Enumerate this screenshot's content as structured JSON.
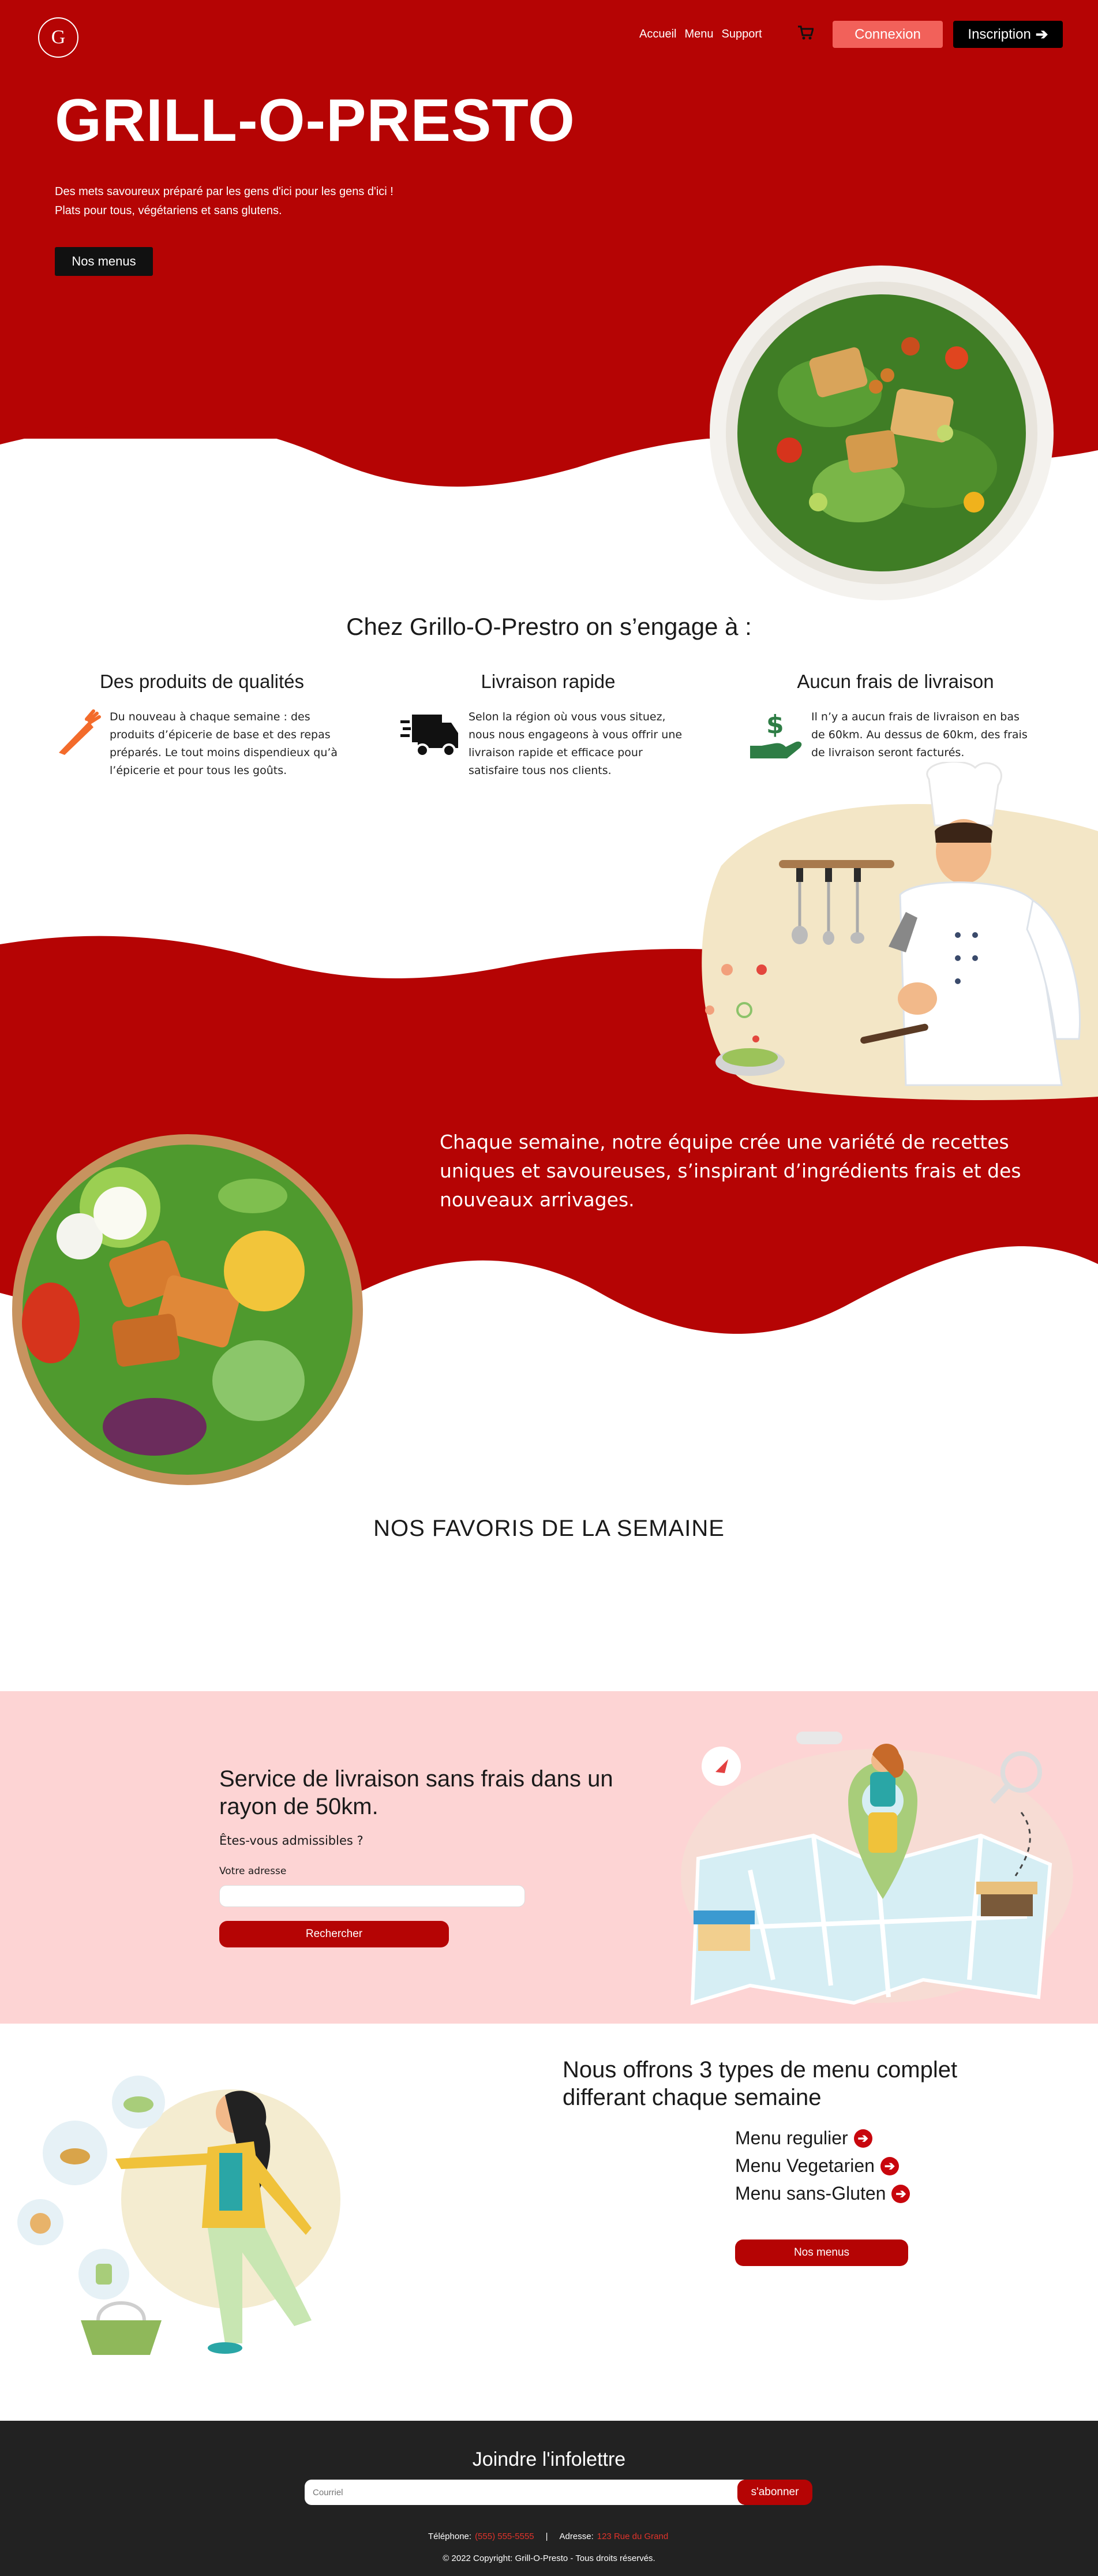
{
  "nav": {
    "logo_letter": "G",
    "links": [
      "Accueil",
      "Menu",
      "Support"
    ],
    "login_label": "Connexion",
    "signup_label": "Inscription"
  },
  "hero": {
    "title": "GRILL-O-PRESTO",
    "subtitle_line1": "Des mets savoureux préparé par les gens d'ici pour les gens d'ici !",
    "subtitle_line2": "Plats pour tous, végétariens et sans glutens.",
    "button_label": "Nos menus"
  },
  "engagement": {
    "title": "Chez Grillo-O-Prestro on s’engage à :",
    "features": [
      {
        "title": "Des produits de qualités",
        "text": "Du nouveau à chaque semaine : des produits d’épicerie de base et des repas préparés. Le tout moins dispendieux qu’à l’épicerie et pour tous les goûts.",
        "icon": "carrot-icon"
      },
      {
        "title": "Livraison rapide",
        "text": "Selon la région où vous vous situez, nous nous engageons à vous offrir une livraison rapide et efficace pour satisfaire tous nos clients.",
        "icon": "delivery-truck-icon"
      },
      {
        "title": "Aucun frais de livraison",
        "text": "Il n’y a aucun frais de livraison en bas de 60km. Au dessus de 60km, des frais de livraison seront facturés.",
        "icon": "money-hand-icon"
      }
    ]
  },
  "quote": {
    "text": "Chaque semaine, notre équipe crée une variété de recettes uniques et savoureuses, s’inspirant d’ingrédients frais et des nouveaux arrivages."
  },
  "favorites": {
    "title": "NOS FAVORIS DE LA SEMAINE"
  },
  "delivery": {
    "title": "Service de livraison sans frais dans un rayon de 50km.",
    "question": "Êtes-vous admissibles ?",
    "address_label": "Votre adresse",
    "address_value": "",
    "search_label": "Rechercher"
  },
  "menus": {
    "title": "Nous offrons 3 types de menu complet differant chaque semaine",
    "items": [
      "Menu regulier",
      "Menu Vegetarien",
      "Menu sans-Gluten"
    ],
    "button_label": "Nos menus"
  },
  "footer": {
    "newsletter_title": "Joindre l'infolettre",
    "email_placeholder": "Courriel",
    "subscribe_label": "s'abonner",
    "phone_label": "Téléphone:",
    "phone_value": "(555) 555-5555",
    "separator": "|",
    "address_label": "Adresse:",
    "address_value": "123 Rue du Grand",
    "copyright": "© 2022 Copyright: Grill-O-Presto - Tous droits réservés."
  },
  "colors": {
    "brand_red": "#b50404",
    "login_coral": "#f2615a",
    "pink_bg": "#fdd4d4",
    "footer_bg": "#222222",
    "link_red": "#e0332b"
  }
}
